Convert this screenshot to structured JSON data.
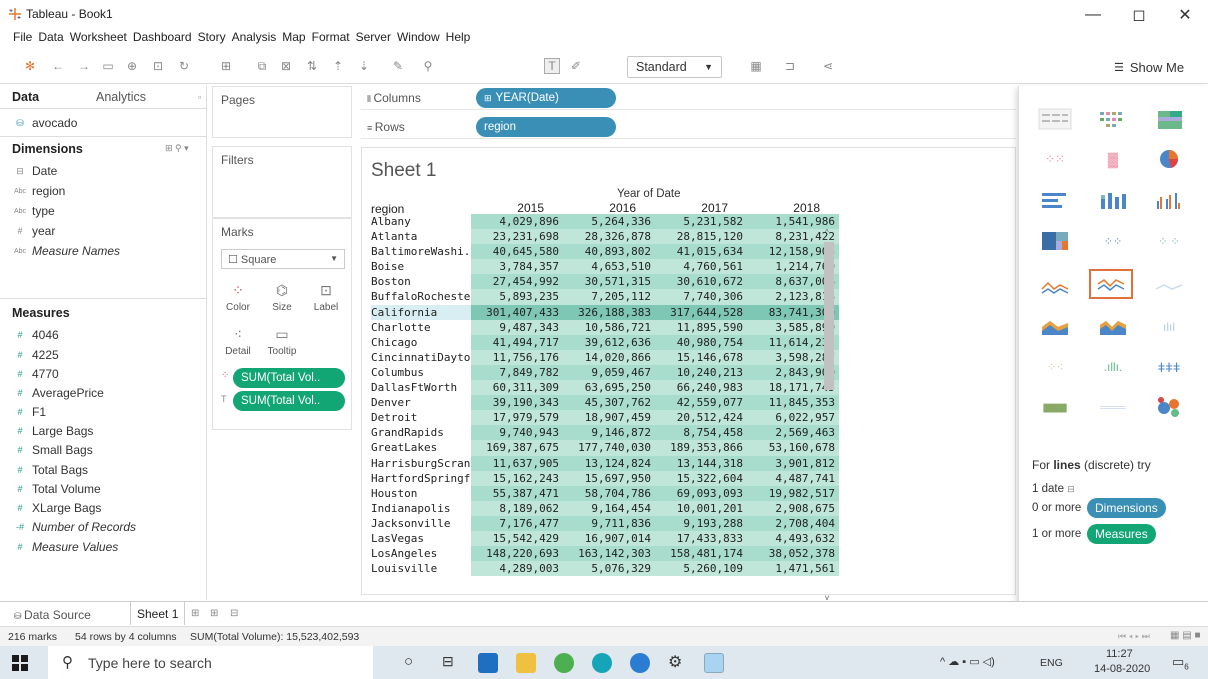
{
  "window": {
    "title": "Tableau - Book1",
    "controls": [
      "—",
      "◻",
      "✕"
    ]
  },
  "menu": [
    "File",
    "Data",
    "Worksheet",
    "Dashboard",
    "Story",
    "Analysis",
    "Map",
    "Format",
    "Server",
    "Window",
    "Help"
  ],
  "toolbar": {
    "fit": "Standard",
    "show_me": "Show Me"
  },
  "data_pane": {
    "tabs": [
      "Data",
      "Analytics"
    ],
    "datasource": "avocado",
    "dimensions_header": "Dimensions",
    "dimensions": [
      {
        "label": "Date",
        "icon": "calendar-icon",
        "glyph": "⊟",
        "italic": false
      },
      {
        "label": "region",
        "icon": "abc-icon",
        "glyph": "Abc",
        "italic": false
      },
      {
        "label": "type",
        "icon": "abc-icon",
        "glyph": "Abc",
        "italic": false
      },
      {
        "label": "year",
        "icon": "hash-icon",
        "glyph": "#",
        "italic": false
      },
      {
        "label": "Measure Names",
        "icon": "abc-icon",
        "glyph": "Abc",
        "italic": true
      }
    ],
    "measures_header": "Measures",
    "measures": [
      {
        "label": "4046",
        "italic": false
      },
      {
        "label": "4225",
        "italic": false
      },
      {
        "label": "4770",
        "italic": false
      },
      {
        "label": "AveragePrice",
        "italic": false
      },
      {
        "label": "F1",
        "italic": false
      },
      {
        "label": "Large Bags",
        "italic": false
      },
      {
        "label": "Small Bags",
        "italic": false
      },
      {
        "label": "Total Bags",
        "italic": false
      },
      {
        "label": "Total Volume",
        "italic": false
      },
      {
        "label": "XLarge Bags",
        "italic": false
      },
      {
        "label": "Number of Records",
        "italic": true
      },
      {
        "label": "Measure Values",
        "italic": true
      }
    ]
  },
  "cards": {
    "pages": "Pages",
    "filters": "Filters",
    "marks": "Marks",
    "mark_type": "Square",
    "mark_buttons": [
      "Color",
      "Size",
      "Label",
      "Detail",
      "Tooltip"
    ],
    "mark_pills": [
      "SUM(Total Vol..",
      "SUM(Total Vol.."
    ]
  },
  "shelves": {
    "columns_label": "Columns",
    "columns_pill": "YEAR(Date)",
    "rows_label": "Rows",
    "rows_pill": "region"
  },
  "view": {
    "sheet_title": "Sheet 1",
    "column_group": "Year of Date",
    "row_header": "region",
    "years": [
      "2015",
      "2016",
      "2017",
      "2018"
    ],
    "rows": [
      {
        "region": "Albany",
        "values": [
          "4,029,896",
          "5,264,336",
          "5,231,582",
          "1,541,986"
        ]
      },
      {
        "region": "Atlanta",
        "values": [
          "23,231,698",
          "28,326,878",
          "28,815,120",
          "8,231,422"
        ]
      },
      {
        "region": "BaltimoreWashi..",
        "values": [
          "40,645,580",
          "40,893,802",
          "41,015,634",
          "12,158,903"
        ]
      },
      {
        "region": "Boise",
        "values": [
          "3,784,357",
          "4,653,510",
          "4,760,561",
          "1,214,760"
        ]
      },
      {
        "region": "Boston",
        "values": [
          "27,454,992",
          "30,571,315",
          "30,610,672",
          "8,637,006"
        ]
      },
      {
        "region": "BuffaloRochester",
        "values": [
          "5,893,235",
          "7,205,112",
          "7,740,306",
          "2,123,818"
        ]
      },
      {
        "region": "California",
        "values": [
          "301,407,433",
          "326,188,383",
          "317,644,528",
          "83,741,309"
        ],
        "selected": true
      },
      {
        "region": "Charlotte",
        "values": [
          "9,487,343",
          "10,586,721",
          "11,895,590",
          "3,585,890"
        ]
      },
      {
        "region": "Chicago",
        "values": [
          "41,494,717",
          "39,612,636",
          "40,980,754",
          "11,614,232"
        ]
      },
      {
        "region": "CincinnatiDayton",
        "values": [
          "11,756,176",
          "14,020,866",
          "15,146,678",
          "3,598,287"
        ]
      },
      {
        "region": "Columbus",
        "values": [
          "7,849,782",
          "9,059,467",
          "10,240,213",
          "2,843,900"
        ]
      },
      {
        "region": "DallasFtWorth",
        "values": [
          "60,311,309",
          "63,695,250",
          "66,240,983",
          "18,171,745"
        ]
      },
      {
        "region": "Denver",
        "values": [
          "39,190,343",
          "45,307,762",
          "42,559,077",
          "11,845,353"
        ]
      },
      {
        "region": "Detroit",
        "values": [
          "17,979,579",
          "18,907,459",
          "20,512,424",
          "6,022,957"
        ]
      },
      {
        "region": "GrandRapids",
        "values": [
          "9,740,943",
          "9,146,872",
          "8,754,458",
          "2,569,463"
        ]
      },
      {
        "region": "GreatLakes",
        "values": [
          "169,387,675",
          "177,740,030",
          "189,353,866",
          "53,160,678"
        ]
      },
      {
        "region": "HarrisburgScran..",
        "values": [
          "11,637,905",
          "13,124,824",
          "13,144,318",
          "3,901,812"
        ]
      },
      {
        "region": "HartfordSpringfi..",
        "values": [
          "15,162,243",
          "15,697,950",
          "15,322,604",
          "4,487,741"
        ]
      },
      {
        "region": "Houston",
        "values": [
          "55,387,471",
          "58,704,786",
          "69,093,093",
          "19,982,517"
        ]
      },
      {
        "region": "Indianapolis",
        "values": [
          "8,189,062",
          "9,164,454",
          "10,001,201",
          "2,908,675"
        ]
      },
      {
        "region": "Jacksonville",
        "values": [
          "7,176,477",
          "9,711,836",
          "9,193,288",
          "2,708,404"
        ]
      },
      {
        "region": "LasVegas",
        "values": [
          "15,542,429",
          "16,907,014",
          "17,433,833",
          "4,493,632"
        ]
      },
      {
        "region": "LosAngeles",
        "values": [
          "148,220,693",
          "163,142,303",
          "158,481,174",
          "38,052,378"
        ]
      },
      {
        "region": "Louisville",
        "values": [
          "4,289,003",
          "5,076,329",
          "5,260,109",
          "1,471,561"
        ]
      }
    ]
  },
  "show_me": {
    "hint_prefix": "For ",
    "hint_bold": "lines",
    "hint_suffix": " (discrete) try",
    "req1": "1 date",
    "req2_prefix": "0 or more",
    "req2_pill": "Dimensions",
    "req3_prefix": "1 or more",
    "req3_pill": "Measures"
  },
  "tabs": {
    "datasource": "Data Source",
    "sheet": "Sheet 1"
  },
  "status": {
    "marks": "216 marks",
    "dims": "54 rows by 4 columns",
    "sum": "SUM(Total Volume): 15,523,402,593"
  },
  "taskbar": {
    "search_placeholder": "Type here to search",
    "lang": "ENG",
    "time": "11:27",
    "date": "14-08-2020",
    "notif_count": "6"
  },
  "colors": {
    "teal_pill": "#12a674",
    "blue_pill": "#3a8fb7",
    "cell": "#a8dccc",
    "selected_chart": "#e0713b"
  }
}
